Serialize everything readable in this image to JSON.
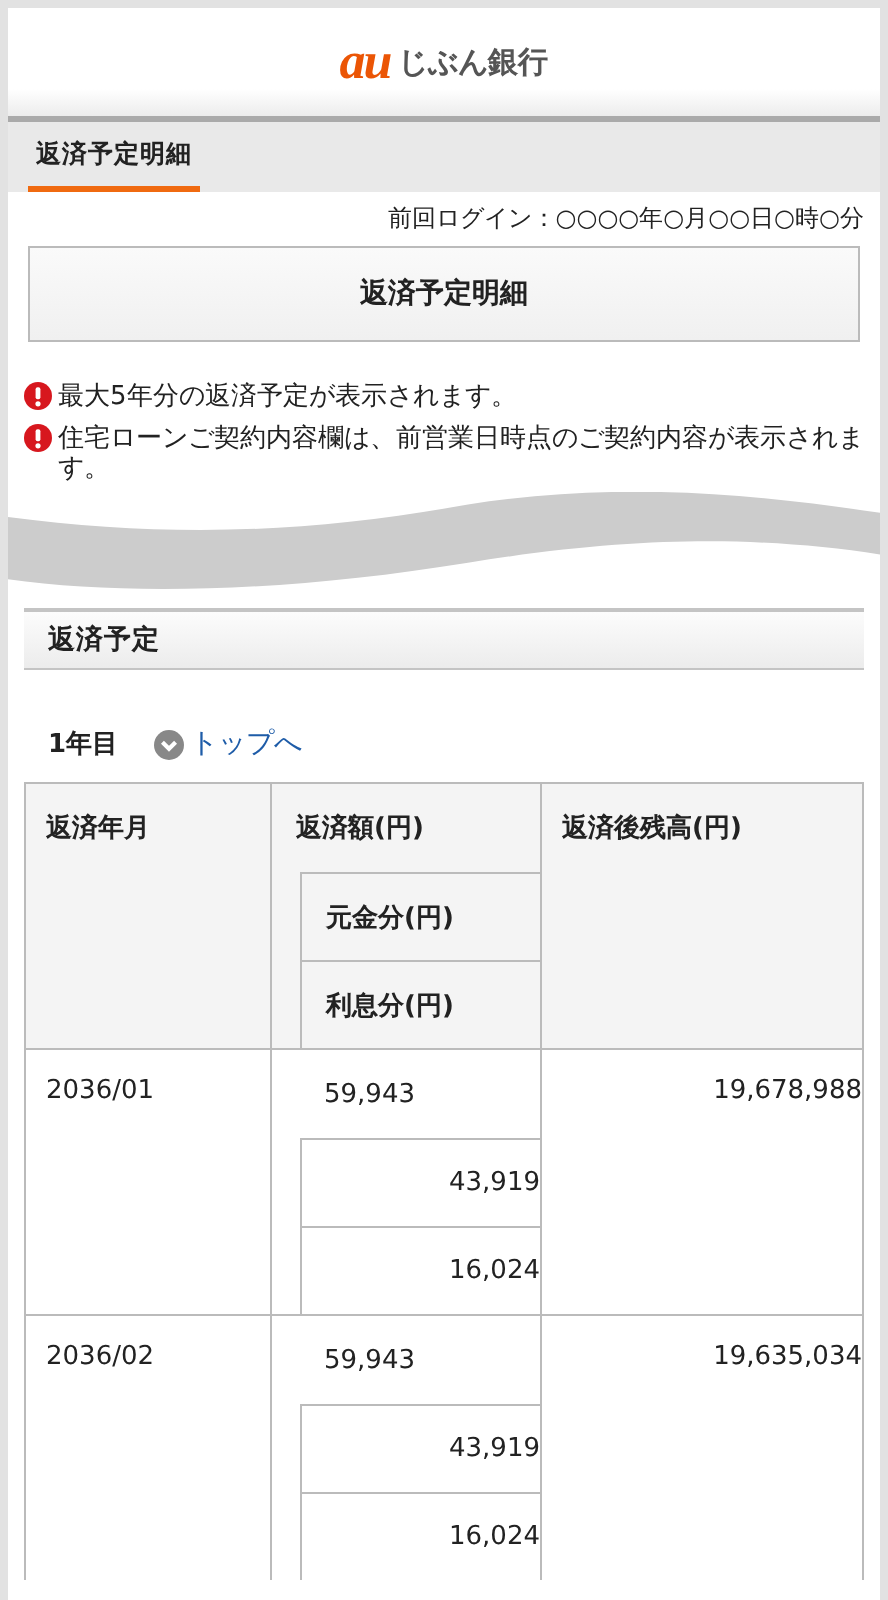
{
  "header": {
    "logo_mark": "au",
    "logo_text": "じぶん銀行"
  },
  "tabs": [
    {
      "label": "返済予定明細",
      "selected": true
    }
  ],
  "last_login": "前回ログイン：○○○○年○月○○日○時○分",
  "title_button": "返済予定明細",
  "notes": [
    "最大5年分の返済予定が表示されます。",
    "住宅ローンご契約内容欄は、前営業日時点のご契約内容が表示されます。"
  ],
  "section_title": "返済予定",
  "year_label": "1年目",
  "top_link": "トップへ",
  "table": {
    "columns": [
      "返済年月",
      "返済額(円)",
      "返済後残高(円)"
    ],
    "subcolumns": [
      "元金分(円)",
      "利息分(円)"
    ],
    "rows": [
      {
        "month": "2036/01",
        "payment": "59,943",
        "balance": "19,678,988",
        "principal": "43,919",
        "interest": "16,024"
      },
      {
        "month": "2036/02",
        "payment": "59,943",
        "balance": "19,635,034",
        "principal": "43,919",
        "interest": "16,024"
      }
    ]
  }
}
